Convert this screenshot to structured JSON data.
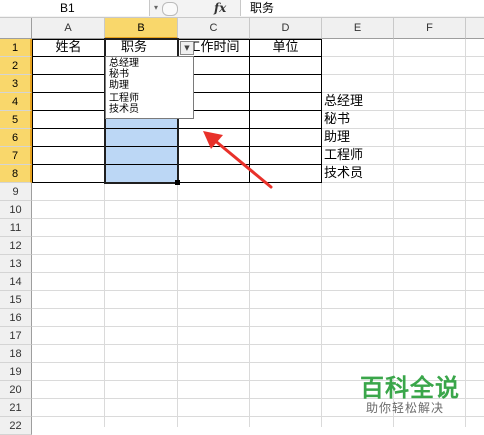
{
  "formula_bar": {
    "name_box": "B1",
    "fx_label": "fx",
    "content": "职务"
  },
  "columns": [
    "A",
    "B",
    "C",
    "D",
    "E",
    "F"
  ],
  "rows": [
    "1",
    "2",
    "3",
    "4",
    "5",
    "6",
    "7",
    "8",
    "9",
    "10",
    "11",
    "12",
    "13",
    "14",
    "15",
    "16",
    "17",
    "18",
    "19",
    "20",
    "21",
    "22"
  ],
  "header_row": {
    "A1": "姓名",
    "B1": "职务",
    "C1": "工作时间",
    "D1": "单位"
  },
  "source_list": [
    "总经理",
    "秘书",
    "助理",
    "工程师",
    "技术员"
  ],
  "dropdown": {
    "options": [
      "总经理",
      "秘书",
      "助理",
      "工程师",
      "技术员"
    ]
  },
  "watermark": {
    "title": "百科全说",
    "subtitle": "助你轻松解决"
  },
  "colors": {
    "selected_header": "#f9d76b",
    "selection_fill": "#bcd7f5",
    "arrow": "#e8312a",
    "watermark": "#3aa64a"
  }
}
